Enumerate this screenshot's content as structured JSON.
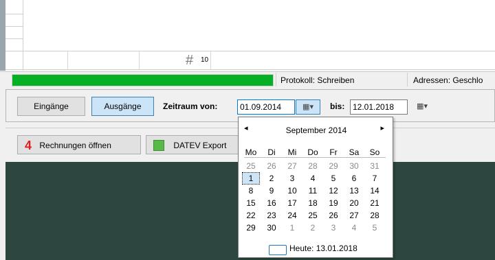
{
  "grid": {
    "hash_symbol": "#",
    "hash_count": "10"
  },
  "status": {
    "progress_percent": 100,
    "progress_color": "#06b025",
    "protokoll": "Protokoll: Schreiben",
    "adressen": "Adressen: Geschlo"
  },
  "toolbar": {
    "eingaenge": "Eingänge",
    "ausgaenge": "Ausgänge",
    "zeitraum_label": "Zeitraum von:",
    "from_date": "01.09.2014",
    "bis_label": "bis:",
    "to_date": "12.01.2018",
    "calendar_icon": "calendar-icon",
    "dropdown_icon": "▾"
  },
  "actions": {
    "rechnungen_number": "4",
    "rechnungen_label": "Rechnungen öffnen",
    "datev_label": "DATEV Export",
    "datev_icon_color": "#57b948"
  },
  "calendar": {
    "prev": "◂",
    "next": "▸",
    "title": "September 2014",
    "weekdays": [
      "Mo",
      "Di",
      "Mi",
      "Do",
      "Fr",
      "Sa",
      "So"
    ],
    "weeks": [
      [
        "25",
        "26",
        "27",
        "28",
        "29",
        "30",
        "31"
      ],
      [
        "1",
        "2",
        "3",
        "4",
        "5",
        "6",
        "7"
      ],
      [
        "8",
        "9",
        "10",
        "11",
        "12",
        "13",
        "14"
      ],
      [
        "15",
        "16",
        "17",
        "18",
        "19",
        "20",
        "21"
      ],
      [
        "22",
        "23",
        "24",
        "25",
        "26",
        "27",
        "28"
      ],
      [
        "29",
        "30",
        "1",
        "2",
        "3",
        "4",
        "5"
      ]
    ],
    "other_month": [
      [
        true,
        true,
        true,
        true,
        true,
        true,
        true
      ],
      [
        false,
        false,
        false,
        false,
        false,
        false,
        false
      ],
      [
        false,
        false,
        false,
        false,
        false,
        false,
        false
      ],
      [
        false,
        false,
        false,
        false,
        false,
        false,
        false
      ],
      [
        false,
        false,
        false,
        false,
        false,
        false,
        false
      ],
      [
        false,
        false,
        true,
        true,
        true,
        true,
        true
      ]
    ],
    "selected_day": "1",
    "today_text": "Heute: 13.01.2018"
  }
}
